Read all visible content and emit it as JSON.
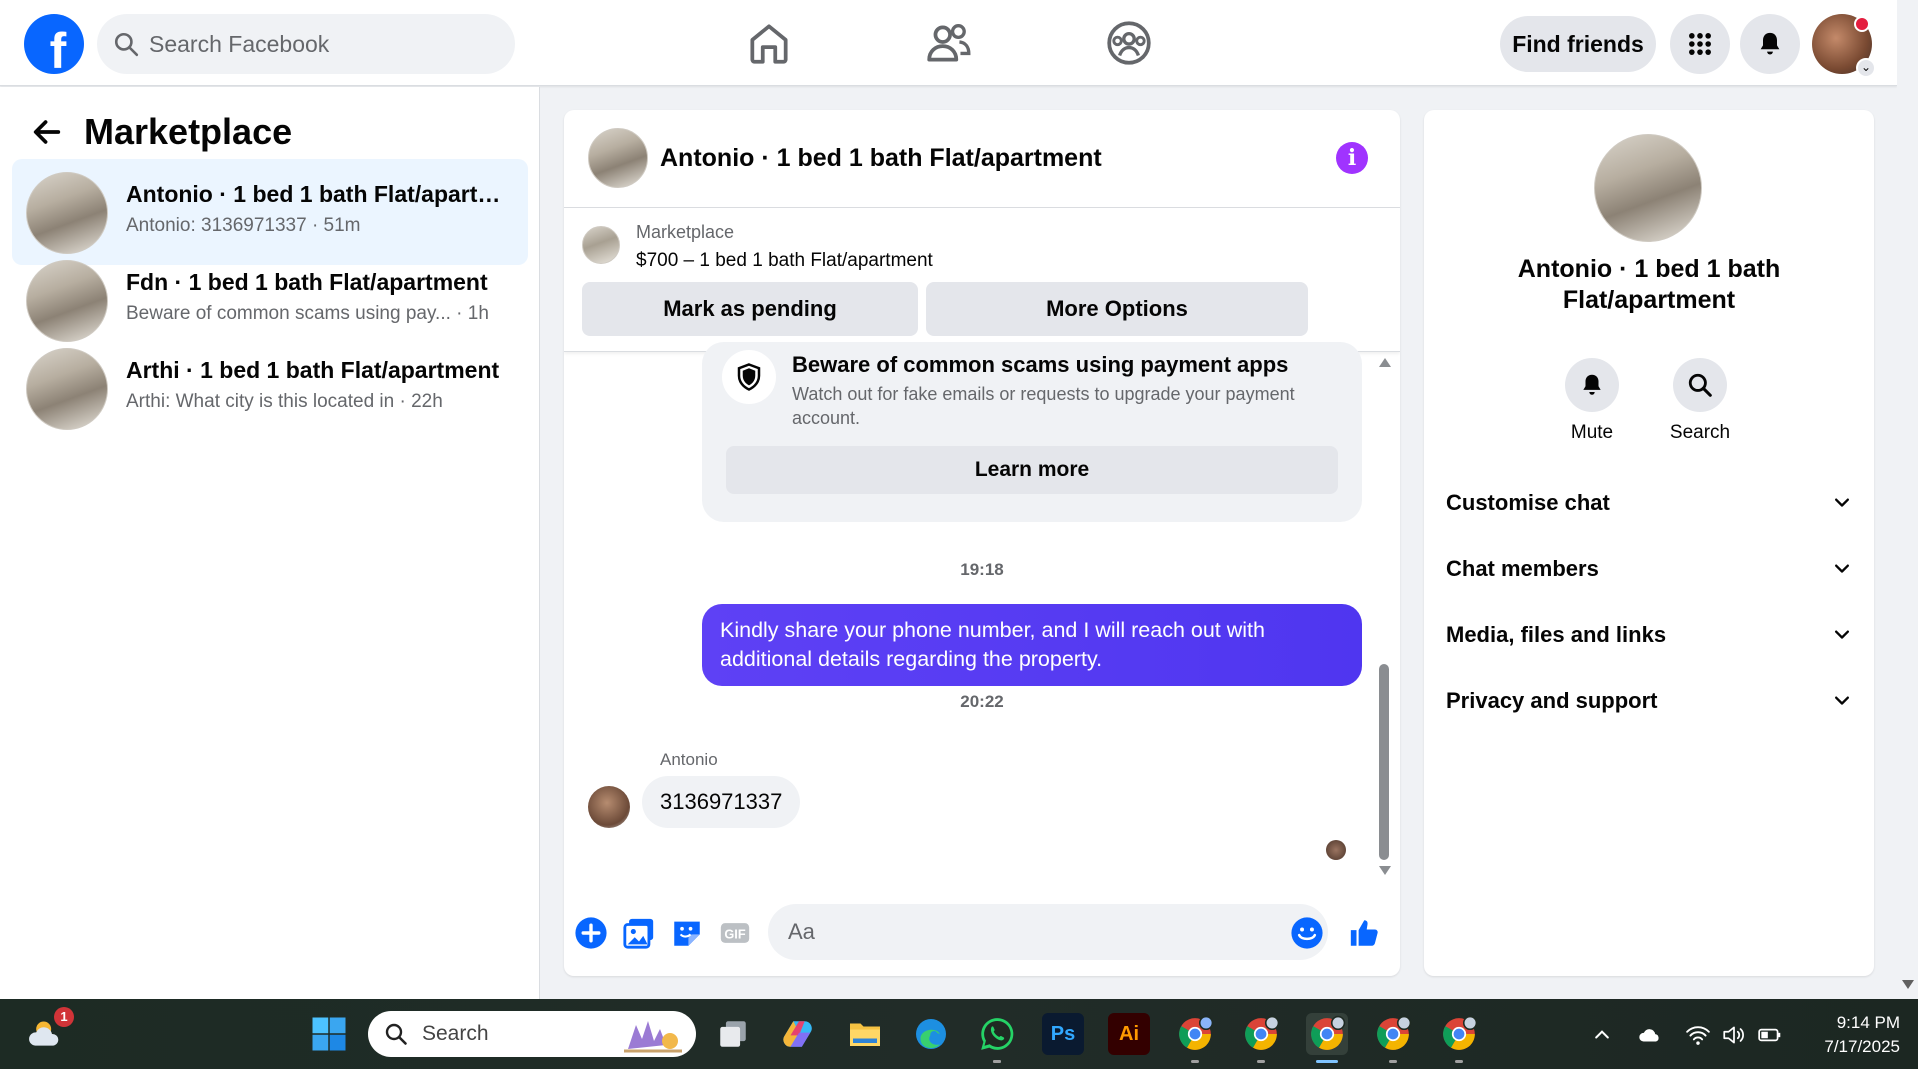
{
  "topbar": {
    "logo_text": "f",
    "search_placeholder": "Search Facebook",
    "nav_icons": [
      "home-icon",
      "friends-icon",
      "groups-icon"
    ],
    "find_friends_label": "Find friends",
    "menu_icon": "grid-menu-icon",
    "notifications_icon": "bell-icon",
    "brand_color": "#0866ff"
  },
  "left": {
    "title": "Marketplace",
    "conversations": [
      {
        "title": "Antonio · 1 bed 1 bath Flat/apartm...",
        "subtitle": "Antonio: 3136971337 · 51m",
        "active": true
      },
      {
        "title": "Fdn · 1 bed 1 bath Flat/apartment",
        "subtitle": "Beware of common scams using pay...  · 1h",
        "active": false
      },
      {
        "title": "Arthi · 1 bed 1 bath Flat/apartment",
        "subtitle": "Arthi: What city is this located in · 22h",
        "active": false
      }
    ]
  },
  "chat": {
    "header_title": "Antonio · 1 bed 1 bath Flat/apartment",
    "info_label": "i",
    "listing": {
      "source": "Marketplace",
      "price_line": "$700 – 1 bed 1 bath Flat/apartment",
      "mark_pending_label": "Mark as pending",
      "more_options_label": "More Options"
    },
    "scam_notice": {
      "title": "Beware of common scams using payment apps",
      "text": "Watch out for fake emails or requests to upgrade your payment account.",
      "learn_more_label": "Learn more"
    },
    "timestamp_1": "19:18",
    "outgoing_message": "Kindly share your phone number, and I will reach out with additional details regarding the property.",
    "timestamp_2": "20:22",
    "sender_name": "Antonio",
    "incoming_message": "3136971337",
    "composer_placeholder": "Aa",
    "accent_color": "#5b3ef7"
  },
  "right": {
    "name": "Antonio · 1 bed 1 bath Flat/apartment",
    "mute_label": "Mute",
    "search_label": "Search",
    "sections": [
      "Customise chat",
      "Chat members",
      "Media, files and links",
      "Privacy and support"
    ]
  },
  "taskbar": {
    "search_placeholder": "Search",
    "weather_badge": "1",
    "time": "9:14 PM",
    "date": "7/17/2025",
    "apps": [
      "windows-start",
      "file-explorer-icon",
      "copilot-icon",
      "folder-icon",
      "edge-icon",
      "whatsapp-icon",
      "photoshop-icon",
      "illustrator-icon",
      "chrome-icon",
      "chrome-icon",
      "chrome-icon",
      "chrome-icon",
      "chrome-icon"
    ],
    "ps_label": "Ps",
    "ai_label": "Ai"
  }
}
